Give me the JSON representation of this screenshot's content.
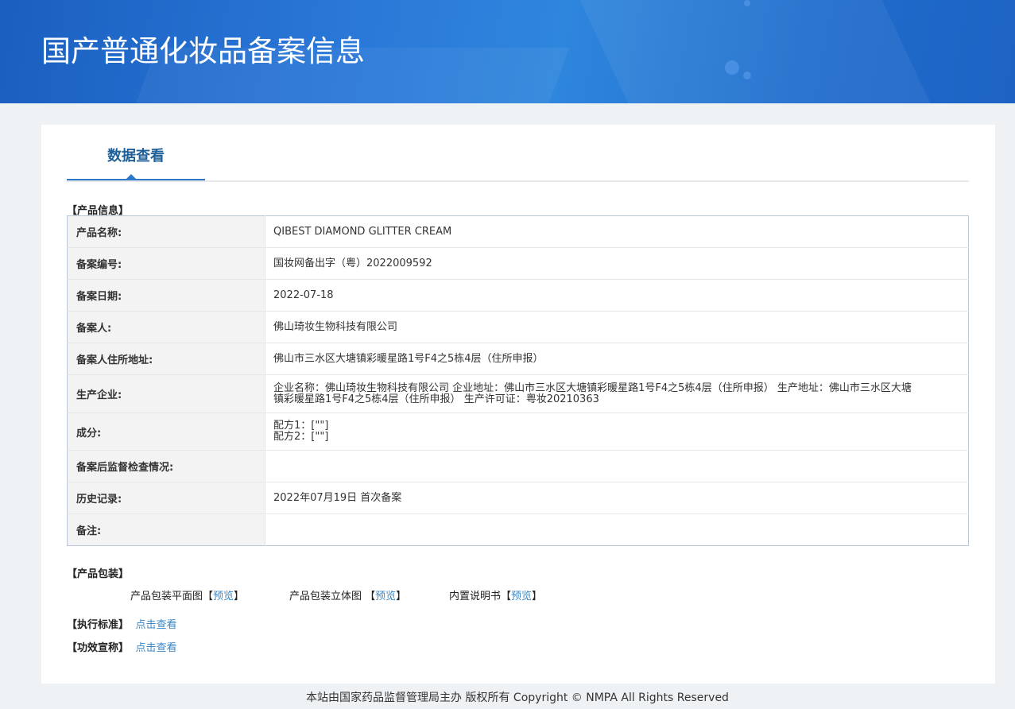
{
  "header": {
    "title": "国产普通化妆品备案信息"
  },
  "tab": {
    "label": "数据查看"
  },
  "sections": {
    "product_info": "【产品信息】",
    "packaging": "【产品包装】",
    "standard": "【执行标准】",
    "efficacy": "【功效宣称】"
  },
  "product_rows": [
    {
      "label": "产品名称:",
      "value": "QIBEST DIAMOND GLITTER CREAM"
    },
    {
      "label": "备案编号:",
      "value": "国妆网备出字（粤）2022009592"
    },
    {
      "label": "备案日期:",
      "value": "2022-07-18"
    },
    {
      "label": "备案人:",
      "value": "佛山琦妆生物科技有限公司"
    },
    {
      "label": "备案人住所地址:",
      "value": "佛山市三水区大塘镇彩暖星路1号F4之5栋4层（住所申报）"
    },
    {
      "label": "生产企业:",
      "value": "企业名称：佛山琦妆生物科技有限公司 企业地址：佛山市三水区大塘镇彩暖星路1号F4之5栋4层（住所申报） 生产地址：佛山市三水区大塘镇彩暖星路1号F4之5栋4层（住所申报） 生产许可证：粤妆20210363"
    },
    {
      "label": "成分:",
      "value_line1": "配方1：[\"\"]",
      "value_line2": "配方2：[\"\"]"
    },
    {
      "label": "备案后监督检查情况:",
      "value": ""
    },
    {
      "label": "历史记录:",
      "value": "2022年07月19日 首次备案"
    },
    {
      "label": "备注:",
      "value": ""
    }
  ],
  "packaging": {
    "flat_label": "产品包装平面图",
    "solid_label": "产品包装立体图 ",
    "manual_label": "内置说明书",
    "bracket_open": "【",
    "bracket_close": "】",
    "preview": "预览"
  },
  "links": {
    "view": "点击查看"
  },
  "footer": {
    "text": "本站由国家药品监督管理局主办 版权所有 Copyright © NMPA All Rights Reserved"
  }
}
